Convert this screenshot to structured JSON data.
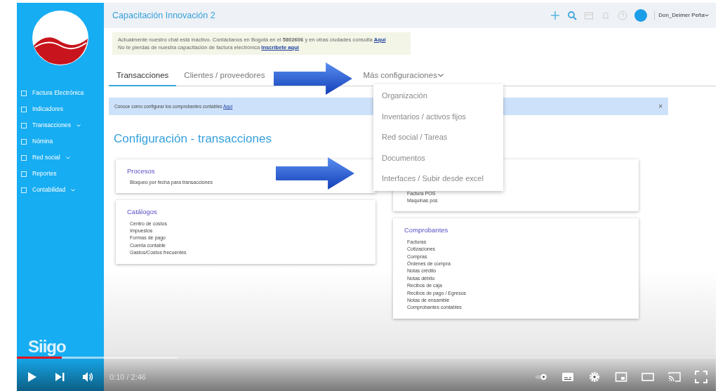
{
  "sidebar": {
    "items": [
      {
        "label": "Factura Electrónica",
        "has_submenu": false
      },
      {
        "label": "Indicadores",
        "has_submenu": false
      },
      {
        "label": "Transacciones",
        "has_submenu": true
      },
      {
        "label": "Nómina",
        "has_submenu": false
      },
      {
        "label": "Red social",
        "has_submenu": true
      },
      {
        "label": "Reportes",
        "has_submenu": false
      },
      {
        "label": "Contabilidad",
        "has_submenu": true
      }
    ],
    "brand": "Siigo"
  },
  "header": {
    "title": "Capacitación Innovación 2",
    "user": "Don_Deimer Peña"
  },
  "notice": [
    {
      "text": "Actualmente nuestro chat está inactivo. Contáctanos en Bogotá en el **5802606** y en otras ciudades consulta",
      "link": "Aquí"
    },
    {
      "text": "No te pierdas de nuestra capacitación de factura electrónica",
      "link": "Inscríbete aquí"
    }
  ],
  "tabs": [
    {
      "label": "Transacciones",
      "kind": "tab",
      "selected": true
    },
    {
      "label": "Clientes / proveedores",
      "kind": "tab",
      "selected": false
    },
    {
      "label": "Más configuraciones",
      "kind": "dropdown",
      "selected": false,
      "expanded": true
    }
  ],
  "dropdown_menu": [
    "Organización",
    "Inventarios / activos fijos",
    "Red social / Tareas",
    "Documentos",
    "Interfaces / Subir desde excel"
  ],
  "info_bar": {
    "text": "Conoce como configurar los comprobantes contables",
    "link": "Aquí",
    "close": "×"
  },
  "heading": "Configuración - transacciones",
  "left_cards": [
    {
      "title": "Procesos",
      "items": [
        "Bloqueo por fecha para transacciones"
      ]
    },
    {
      "title": "Catálogos",
      "items": [
        "Centro de costos",
        "Impuestos",
        "Formas de pago",
        "Cuenta contable",
        "Gastos/Costos frecuentes"
      ]
    }
  ],
  "right_cards": [
    {
      "items": [
        "Factura POS",
        "Maquinas pos"
      ]
    },
    {
      "title": "Comprobantes",
      "items": [
        "Facturas",
        "Cotizaciones",
        "Compras",
        "Órdenes de compra",
        "Notas crédito",
        "Notas débito",
        "Recibos de caja",
        "Recibos de pago / Egresos",
        "Notas de ensamble",
        "Comprobantes contables"
      ]
    }
  ],
  "player": {
    "time": "0:10 / 2:46",
    "progress": {
      "level": 0.064
    },
    "buffered": {
      "level": 0.23
    },
    "autoplay": {
      "on": true
    }
  }
}
